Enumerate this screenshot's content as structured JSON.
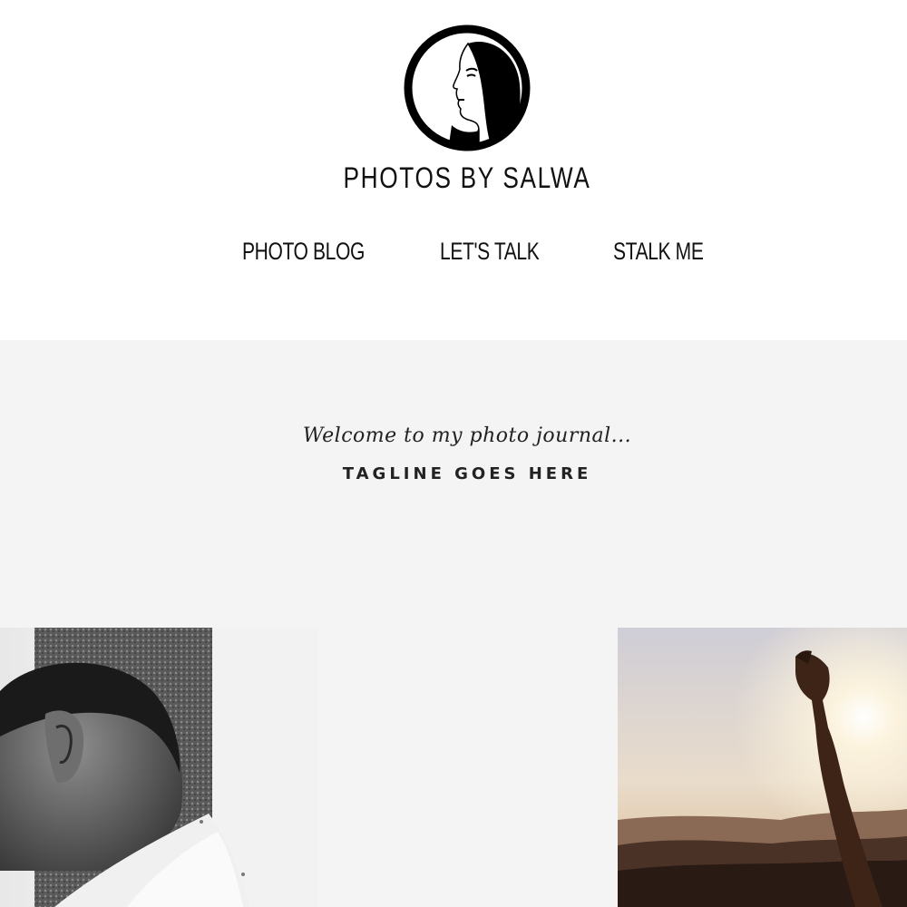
{
  "brand": {
    "name": "PHOTOS BY SALWA",
    "logo_icon": "woman-portrait-circle-logo"
  },
  "nav": {
    "items": [
      {
        "label": "PHOTO BLOG"
      },
      {
        "label": "LET'S TALK"
      },
      {
        "label": "STALK ME"
      }
    ]
  },
  "hero": {
    "welcome": "Welcome to my photo journal...",
    "tagline": "TAGLINE GOES HERE",
    "background": "#f4f4f4"
  },
  "gallery": {
    "items": [
      {
        "description_icon": "man-portrait-bw-photo"
      },
      {
        "description_icon": "raised-arm-sunset-photo"
      }
    ]
  }
}
